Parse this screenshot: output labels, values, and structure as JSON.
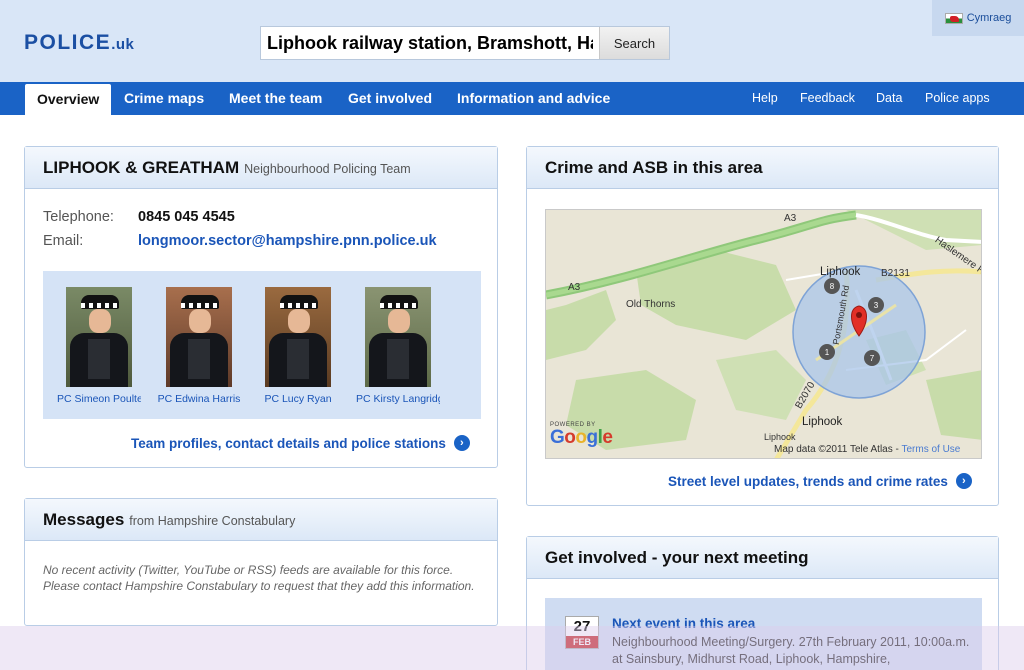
{
  "header": {
    "logo_main": "POLICE",
    "logo_suffix": ".uk",
    "search_value": "Liphook railway station, Bramshott, Hampshire",
    "search_button": "Search",
    "language_link": "Cymraeg"
  },
  "nav": {
    "left": [
      {
        "label": "Overview"
      },
      {
        "label": "Crime maps"
      },
      {
        "label": "Meet the team"
      },
      {
        "label": "Get involved"
      },
      {
        "label": "Information and advice"
      }
    ],
    "right": [
      {
        "label": "Help"
      },
      {
        "label": "Feedback"
      },
      {
        "label": "Data"
      },
      {
        "label": "Police apps"
      }
    ]
  },
  "team_panel": {
    "title": "LIPHOOK & GREATHAM",
    "subtitle": "Neighbourhood Policing Team",
    "telephone_label": "Telephone:",
    "telephone_value": "0845 045 4545",
    "email_label": "Email:",
    "email_value": "longmoor.sector@hampshire.pnn.police.uk",
    "officers": [
      {
        "name": "PC Simeon Poulter"
      },
      {
        "name": "PC Edwina Harris"
      },
      {
        "name": "PC Lucy Ryan"
      },
      {
        "name": "PC Kirsty Langridge"
      }
    ],
    "profiles_link": "Team profiles, contact details and police stations"
  },
  "messages_panel": {
    "title": "Messages",
    "subtitle": "from Hampshire Constabulary",
    "text": "No recent activity (Twitter, YouTube or RSS) feeds are available for this force. Please contact Hampshire Constabulary to request that they add this information."
  },
  "crime_panel": {
    "title": "Crime and ASB in this area",
    "map": {
      "labels": {
        "a3_top": "A3",
        "a3_left": "A3",
        "liphook_top": "Liphook",
        "b2131": "B2131",
        "haslemere": "Haslemere Rd",
        "old_thorns": "Old Thorns",
        "portsmouth": "Portsmouth Rd",
        "b2070": "B2070",
        "liphook_bottom": "Liphook",
        "liphook_small": "Liphook"
      },
      "clusters": [
        "8",
        "3",
        "1",
        "7"
      ],
      "powered_by": "POWERED BY",
      "google": "Google",
      "map_data": "Map data ©2011 Tele Atlas -",
      "terms": "Terms of Use"
    },
    "link": "Street level updates, trends and crime rates"
  },
  "meeting_panel": {
    "title": "Get involved - your next meeting",
    "calendar_day": "27",
    "calendar_month": "FEB",
    "event_title": "Next event in this area",
    "event_text": "Neighbourhood Meeting/Surgery. 27th February 2011, 10:00a.m. at Sainsbury, Midhurst Road, Liphook, Hampshire,"
  }
}
